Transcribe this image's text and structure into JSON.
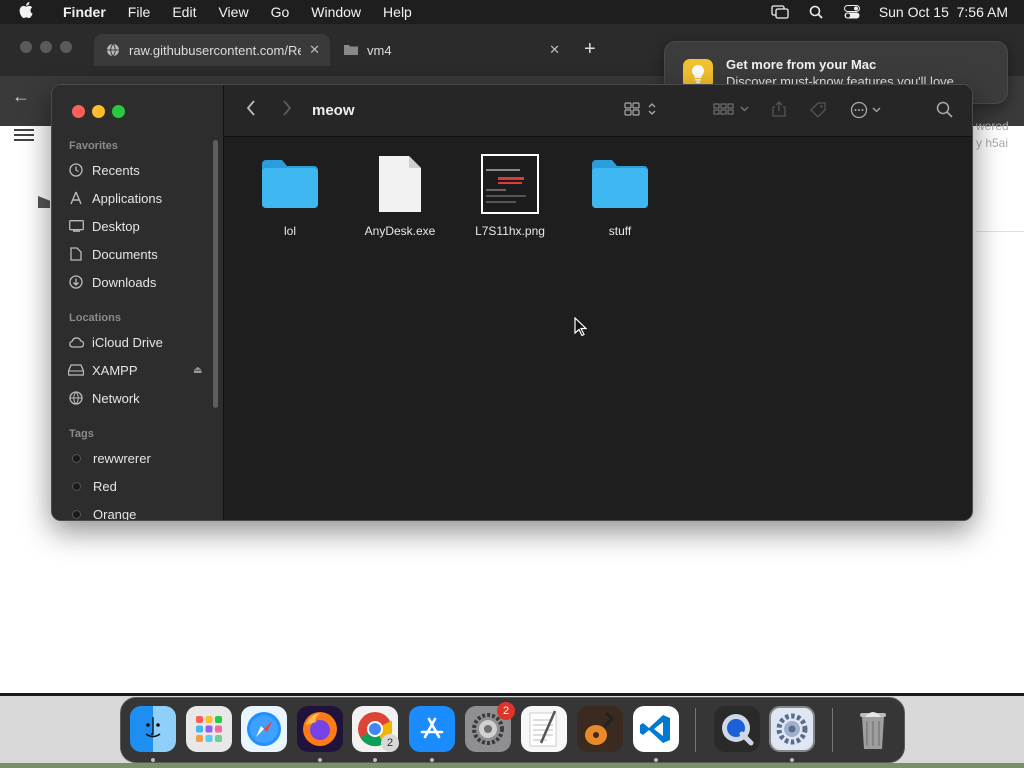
{
  "menubar": {
    "app_name": "Finder",
    "menus": [
      "File",
      "Edit",
      "View",
      "Go",
      "Window",
      "Help"
    ],
    "datetime": "Sun Oct 15  7:56 AM"
  },
  "browser": {
    "tabs": [
      {
        "title": "raw.githubusercontent.com/Re",
        "close": "✕"
      },
      {
        "title": "vm4",
        "close": "✕"
      }
    ],
    "new_tab": "+",
    "powered_text_1": "wered",
    "powered_text_2": "y h5ai"
  },
  "notification": {
    "title": "Get more from your Mac",
    "body": "Discover must-know features you'll love."
  },
  "finder": {
    "title": "meow",
    "sidebar": {
      "favorites_header": "Favorites",
      "favorites": [
        "Recents",
        "Applications",
        "Desktop",
        "Documents",
        "Downloads"
      ],
      "locations_header": "Locations",
      "locations": [
        "iCloud Drive",
        "XAMPP",
        "Network"
      ],
      "tags_header": "Tags",
      "tags": [
        "rewwrerer",
        "Red",
        "Orange"
      ]
    },
    "files": [
      {
        "name": "lol",
        "kind": "folder"
      },
      {
        "name": "AnyDesk.exe",
        "kind": "document"
      },
      {
        "name": "L7S11hx.png",
        "kind": "image"
      },
      {
        "name": "stuff",
        "kind": "folder"
      }
    ]
  },
  "dock": {
    "apps": [
      "Finder",
      "Launchpad",
      "Safari",
      "Firefox",
      "Chrome",
      "App Store",
      "System Preferences",
      "TextEdit",
      "GarageBand",
      "Visual Studio Code",
      "QuickTime Player",
      "System Settings",
      "Trash"
    ],
    "badges": {
      "system_preferences": "2",
      "chrome": "2"
    }
  },
  "colors": {
    "folder_blue": "#3fb8f2",
    "notification_icon": "#f2c230",
    "close_red": "#ff5f57",
    "minimize_yellow": "#febc2e",
    "zoom_green": "#28c840"
  }
}
